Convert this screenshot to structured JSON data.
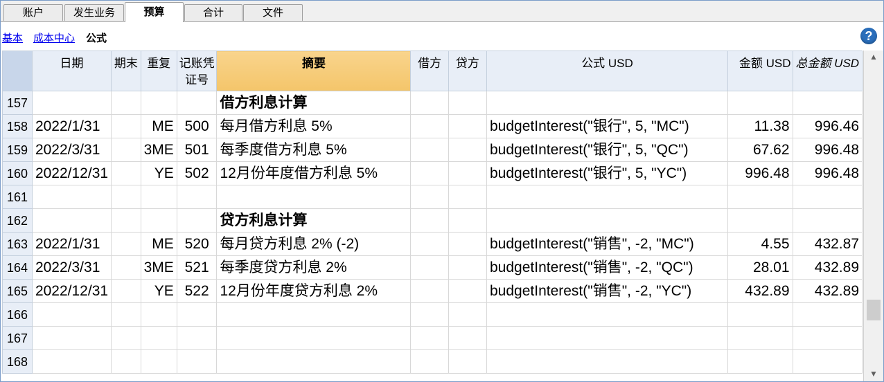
{
  "tabs": [
    "账户",
    "发生业务",
    "预算",
    "合计",
    "文件"
  ],
  "active_tab": "预算",
  "subnav": {
    "basic": "基本",
    "cost_center": "成本中心",
    "formula": "公式"
  },
  "help_icon": "?",
  "columns": {
    "date": "日期",
    "period_end": "期末",
    "repeat": "重复",
    "voucher": "记账凭证号",
    "description": "摘要",
    "debit": "借方",
    "credit": "贷方",
    "formula": "公式 USD",
    "amount": "金额 USD",
    "total": "总金额 USD"
  },
  "rows": [
    {
      "num": "157",
      "date": "",
      "end": "",
      "repeat": "",
      "doc": "",
      "desc": "借方利息计算",
      "bold": true,
      "debit": "",
      "credit": "",
      "formula": "",
      "amount": "",
      "total": ""
    },
    {
      "num": "158",
      "date": "2022/1/31",
      "end": "",
      "repeat": "ME",
      "doc": "500",
      "desc": "每月借方利息 5%",
      "bold": false,
      "debit": "",
      "credit": "",
      "formula": "budgetInterest(\"银行\", 5, \"MC\")",
      "amount": "11.38",
      "total": "996.46"
    },
    {
      "num": "159",
      "date": "2022/3/31",
      "end": "",
      "repeat": "3ME",
      "doc": "501",
      "desc": "每季度借方利息 5%",
      "bold": false,
      "debit": "",
      "credit": "",
      "formula": "budgetInterest(\"银行\", 5, \"QC\")",
      "amount": "67.62",
      "total": "996.48"
    },
    {
      "num": "160",
      "date": "2022/12/31",
      "end": "",
      "repeat": "YE",
      "doc": "502",
      "desc": "12月份年度借方利息 5%",
      "bold": false,
      "debit": "",
      "credit": "",
      "formula": "budgetInterest(\"银行\", 5, \"YC\")",
      "amount": "996.48",
      "total": "996.48"
    },
    {
      "num": "161",
      "date": "",
      "end": "",
      "repeat": "",
      "doc": "",
      "desc": "",
      "bold": false,
      "debit": "",
      "credit": "",
      "formula": "",
      "amount": "",
      "total": ""
    },
    {
      "num": "162",
      "date": "",
      "end": "",
      "repeat": "",
      "doc": "",
      "desc": "贷方利息计算",
      "bold": true,
      "debit": "",
      "credit": "",
      "formula": "",
      "amount": "",
      "total": ""
    },
    {
      "num": "163",
      "date": "2022/1/31",
      "end": "",
      "repeat": "ME",
      "doc": "520",
      "desc": "每月贷方利息 2% (-2)",
      "bold": false,
      "debit": "",
      "credit": "",
      "formula": "budgetInterest(\"销售\", -2, \"MC\")",
      "amount": "4.55",
      "total": "432.87"
    },
    {
      "num": "164",
      "date": "2022/3/31",
      "end": "",
      "repeat": "3ME",
      "doc": "521",
      "desc": "每季度贷方利息 2%",
      "bold": false,
      "debit": "",
      "credit": "",
      "formula": "budgetInterest(\"销售\", -2, \"QC\")",
      "amount": "28.01",
      "total": "432.89"
    },
    {
      "num": "165",
      "date": "2022/12/31",
      "end": "",
      "repeat": "YE",
      "doc": "522",
      "desc": "12月份年度贷方利息 2%",
      "bold": false,
      "debit": "",
      "credit": "",
      "formula": "budgetInterest(\"销售\", -2, \"YC\")",
      "amount": "432.89",
      "total": "432.89"
    },
    {
      "num": "166",
      "date": "",
      "end": "",
      "repeat": "",
      "doc": "",
      "desc": "",
      "bold": false,
      "debit": "",
      "credit": "",
      "formula": "",
      "amount": "",
      "total": ""
    },
    {
      "num": "167",
      "date": "",
      "end": "",
      "repeat": "",
      "doc": "",
      "desc": "",
      "bold": false,
      "debit": "",
      "credit": "",
      "formula": "",
      "amount": "",
      "total": ""
    },
    {
      "num": "168",
      "date": "",
      "end": "",
      "repeat": "",
      "doc": "",
      "desc": "",
      "bold": false,
      "debit": "",
      "credit": "",
      "formula": "",
      "amount": "",
      "total": ""
    }
  ]
}
